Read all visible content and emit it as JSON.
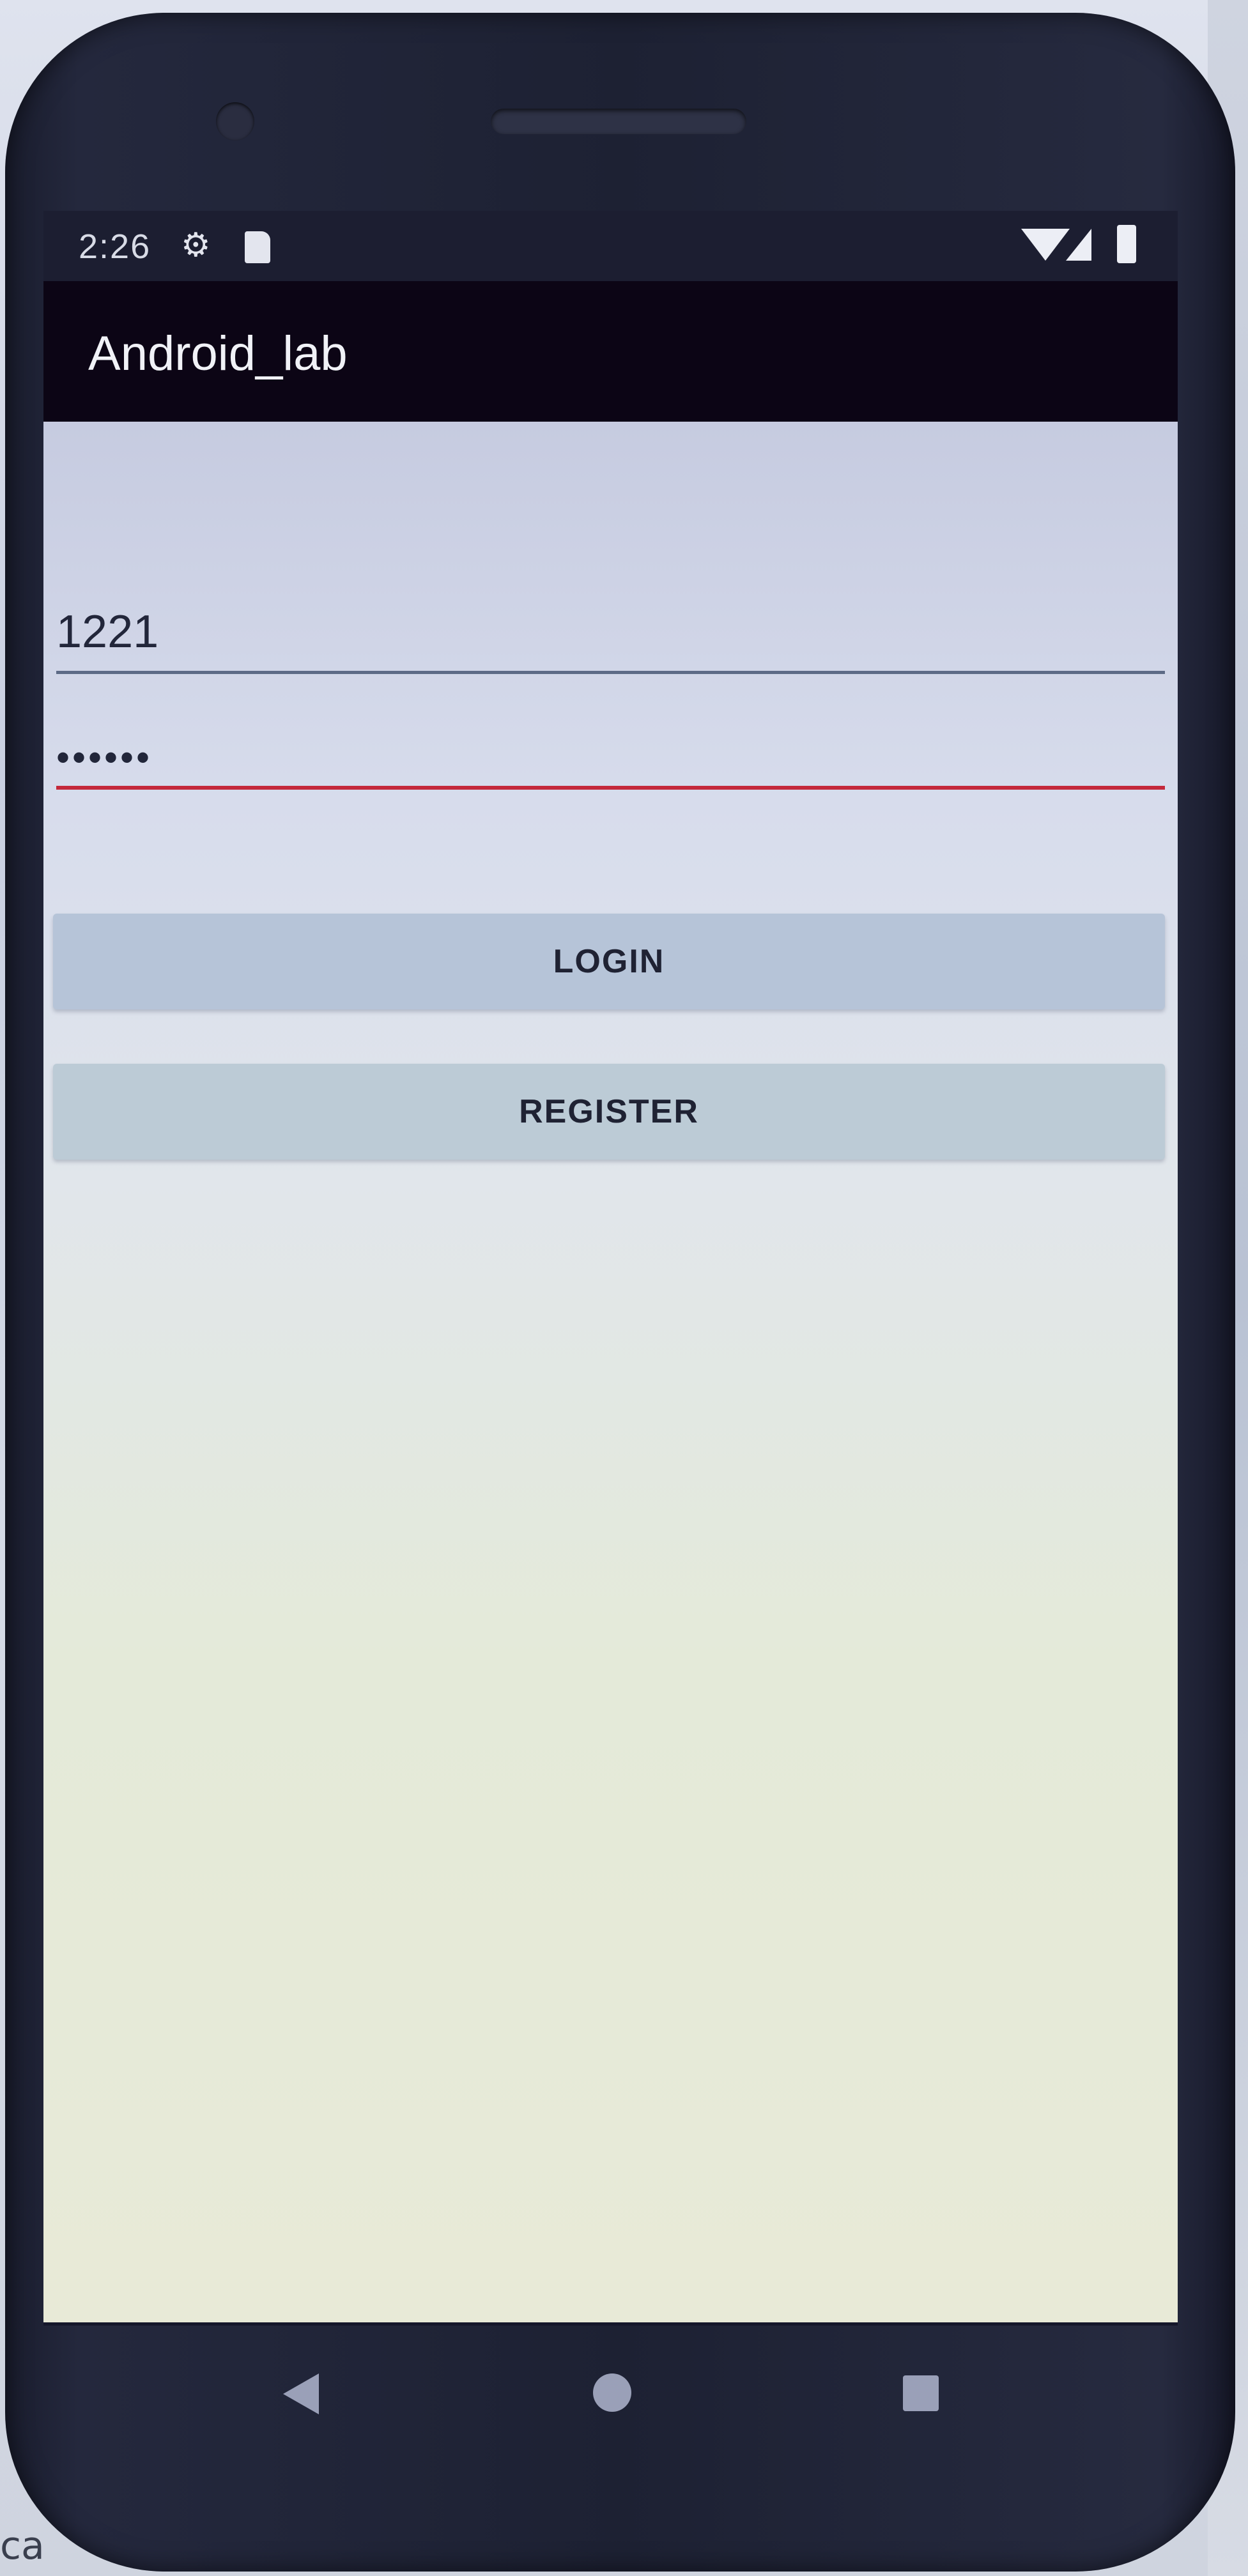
{
  "status_bar": {
    "time": "2:26",
    "icons": [
      "gear-icon",
      "sim-card-icon",
      "wifi-icon",
      "signal-icon",
      "battery-icon"
    ]
  },
  "app_bar": {
    "title": "Android_lab"
  },
  "form": {
    "username_value": "1221",
    "password_value": "••••••",
    "login_label": "LOGIN",
    "register_label": "REGISTER"
  },
  "nav_bar": {
    "icons": [
      "back-icon",
      "home-icon",
      "recents-icon"
    ]
  },
  "background": {
    "corner_text": "ca"
  },
  "colors": {
    "app_bar": "#0c0515",
    "password_underline": "#c4283b",
    "username_underline": "#5d6a86",
    "button_bg": "#b6c4d8"
  }
}
